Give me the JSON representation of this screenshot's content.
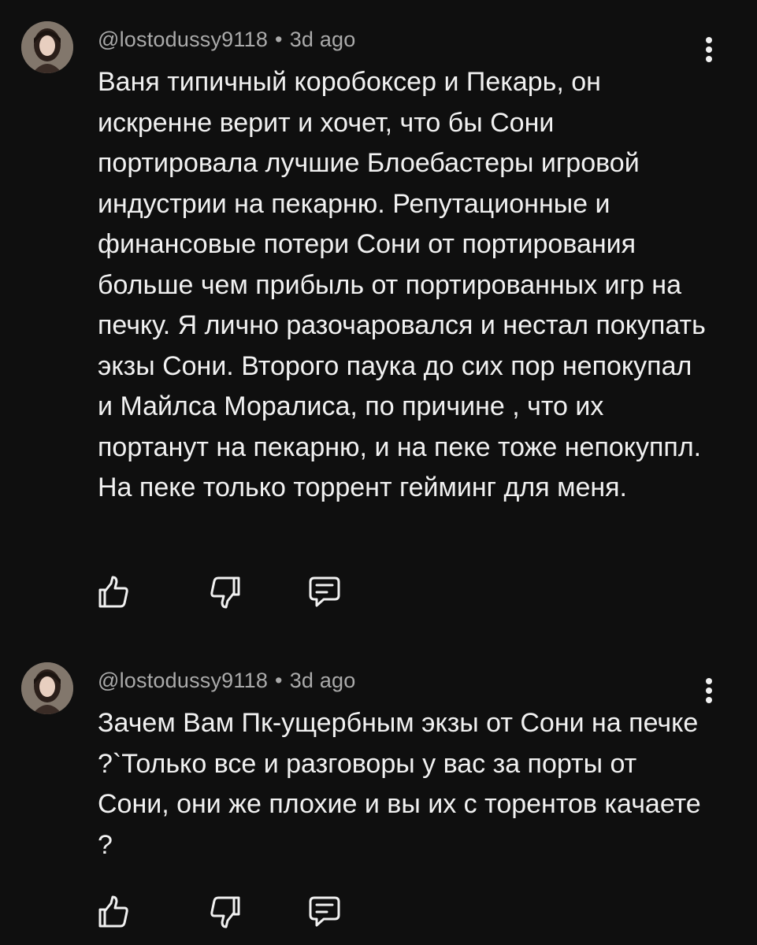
{
  "comments": [
    {
      "author": "@lostodussy9118",
      "separator": "•",
      "time": "3d ago",
      "text": "Ваня типичный коробоксер и Пекарь, он искренне верит и хочет, что бы Сони портировала лучшие Блоебастеры игровой индустрии на пекарню. Репутационные и финансовые потери Сони от портирования больше чем прибыль от портированных игр на печку. Я лично разочаровался и нестал покупать экзы Сони. Второго паука до сих пор непокупал и Майлса Моралиса, по причине , что их портанут на пекарню, и на пеке тоже непокуппл. На пеке только торрент гейминг для меня."
    },
    {
      "author": "@lostodussy9118",
      "separator": "•",
      "time": "3d ago",
      "text": "Зачем Вам Пк-ущербным экзы от Сони на печке ?`Только все и разговоры у вас за порты от Сони, они же плохие и вы их с торентов качаете ?"
    }
  ],
  "icons": {
    "like": "thumb-up-icon",
    "dislike": "thumb-down-icon",
    "reply": "reply-comment-icon",
    "more": "more-vertical-icon"
  },
  "colors": {
    "background": "#0f0f0f",
    "text": "#f1f1f1",
    "meta": "#aaaaaa"
  }
}
